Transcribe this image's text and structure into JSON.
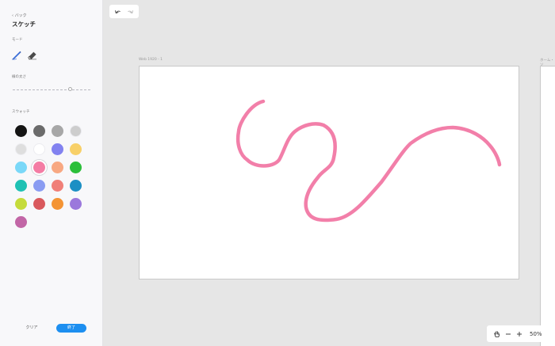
{
  "sidebar": {
    "back_label": "‹ バック",
    "title": "スケッチ",
    "mode_label": "モード",
    "modes": [
      {
        "name": "pen",
        "icon": "pen-icon",
        "selected": true
      },
      {
        "name": "eraser",
        "icon": "eraser-icon",
        "selected": false
      }
    ],
    "stroke_label": "線の太さ",
    "stroke_level": 0.74,
    "swatch_label": "スウォッチ",
    "swatches": [
      "#141414",
      "#6b6b6b",
      "#a7a7a7",
      "#cdcdcd",
      "#dedede",
      "#ffffff",
      "#8282f0",
      "#f8d068",
      "#7ad8f8",
      "#f47ca4",
      "#f8a882",
      "#2bbf3a",
      "#1fc1b4",
      "#8a9cf2",
      "#f07f78",
      "#1c8fc4",
      "#c5db3b",
      "#d9595d",
      "#f49434",
      "#9b78dc",
      "#c266a6"
    ],
    "selected_swatch": 9,
    "clear_label": "クリア",
    "done_label": "終了"
  },
  "toolbar": {
    "undo_icon": "undo-icon",
    "redo_icon": "redo-icon"
  },
  "canvas": {
    "artboard_label": "Web 1920 - 1",
    "artboard2_label": "ホーム・ソ",
    "stroke_color": "#f27fa9"
  },
  "zoom": {
    "pan_icon": "hand-icon",
    "out_icon": "minus-icon",
    "in_icon": "plus-icon",
    "level": "50%"
  },
  "colors": {
    "accent": "#1d8ff0",
    "sidebar_bg": "#f8f8fa",
    "canvas_bg": "#e6e6e6"
  }
}
